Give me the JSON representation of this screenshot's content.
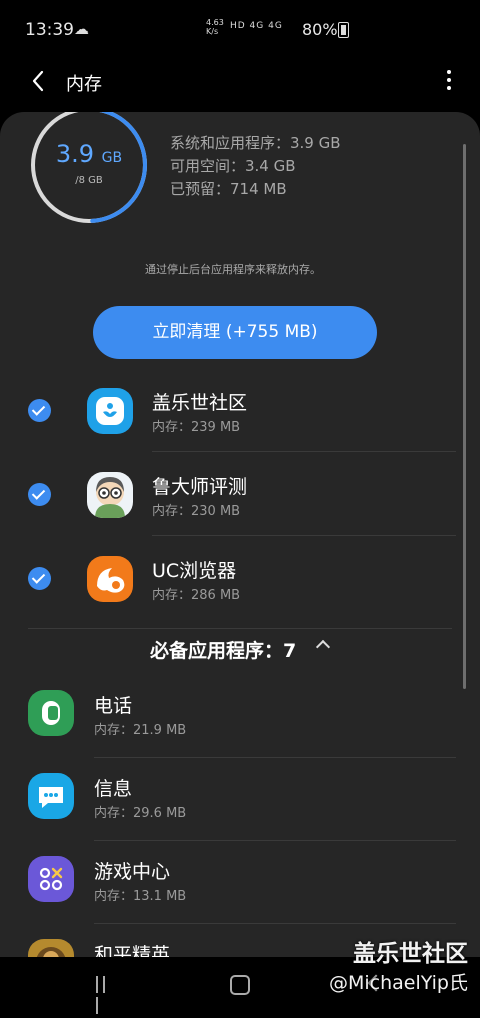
{
  "status_bar": {
    "time": "13:39",
    "weather": "☁",
    "net_speed_value": "4.63",
    "net_speed_unit": "K/s",
    "icons": "HD 4G 4G",
    "battery": "80%"
  },
  "app_bar": {
    "title": "内存"
  },
  "memory": {
    "used": "3.9",
    "used_unit": "GB",
    "total": "/8 GB",
    "used_fraction": 0.49,
    "stats": [
      "系统和应用程序：3.9 GB",
      "可用空间：3.4 GB",
      "已预留：714 MB"
    ],
    "hint": "通过停止后台应用程序来释放内存。",
    "clean_button": "立即清理 (+755 MB)"
  },
  "running_apps": [
    {
      "name": "盖乐世社区",
      "memory": "内存：239 MB",
      "icon": "galaxy-community-icon",
      "checked": true
    },
    {
      "name": "鲁大师评测",
      "memory": "内存：230 MB",
      "icon": "ludashi-icon",
      "checked": true
    },
    {
      "name": "UC浏览器",
      "memory": "内存：286 MB",
      "icon": "uc-browser-icon",
      "checked": true
    }
  ],
  "essential_section": {
    "title": "必备应用程序：7"
  },
  "essential_apps": [
    {
      "name": "电话",
      "memory": "内存：21.9 MB",
      "icon": "phone-icon",
      "color": "#2f9e56"
    },
    {
      "name": "信息",
      "memory": "内存：29.6 MB",
      "icon": "message-icon",
      "color": "#1aa7e6"
    },
    {
      "name": "游戏中心",
      "memory": "内存：13.1 MB",
      "icon": "game-center-icon",
      "color": "#6b58d8"
    },
    {
      "name": "和平精英",
      "memory": "",
      "icon": "game-pubg-icon",
      "color": "#b58a2e"
    }
  ],
  "watermark": {
    "line1": "盖乐世社区",
    "line2": "@MichaelYip氏"
  }
}
